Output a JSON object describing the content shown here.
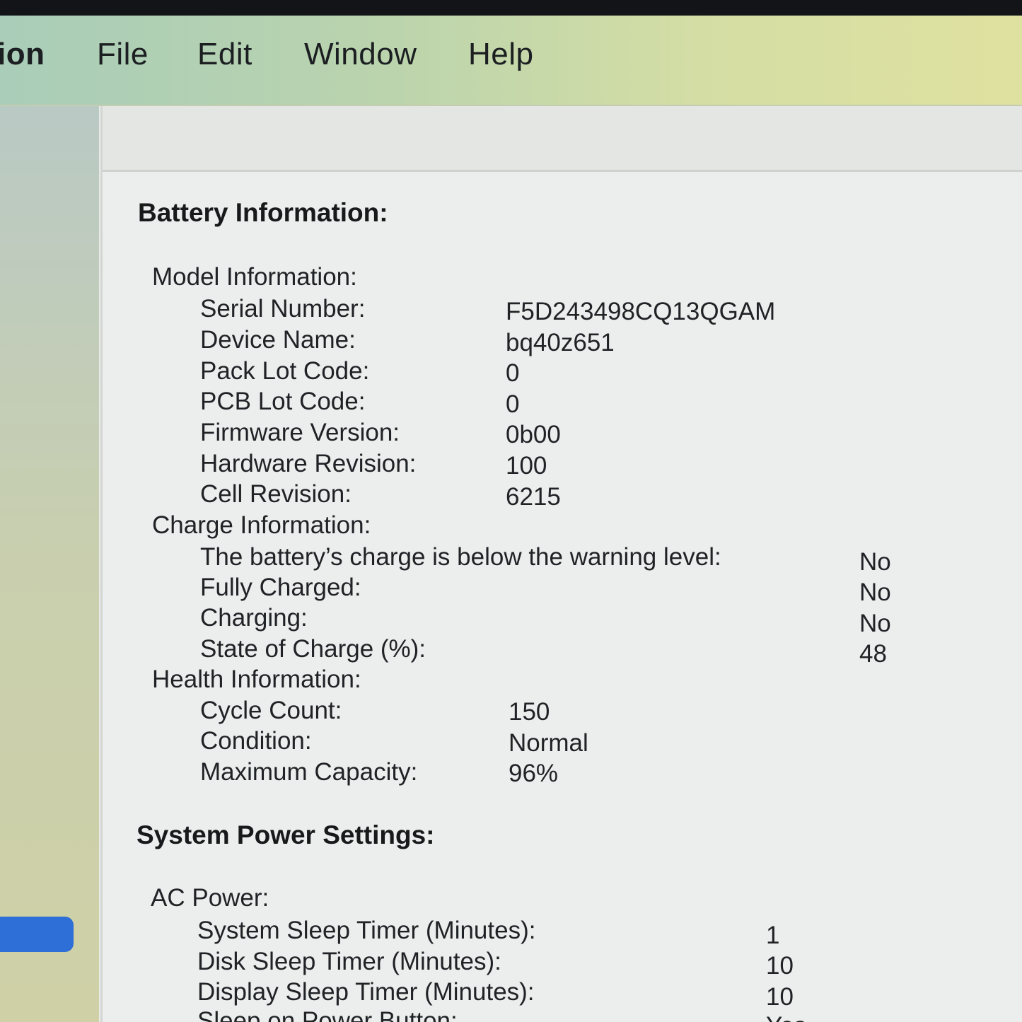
{
  "menubar": {
    "app_name": "ion",
    "items": [
      "File",
      "Edit",
      "Window",
      "Help"
    ]
  },
  "battery": {
    "title": "Battery Information:",
    "model": {
      "heading": "Model Information:",
      "rows": [
        {
          "label": "Serial Number:",
          "value": "F5D243498CQ13QGAM"
        },
        {
          "label": "Device Name:",
          "value": "bq40z651"
        },
        {
          "label": "Pack Lot Code:",
          "value": "0"
        },
        {
          "label": "PCB Lot Code:",
          "value": "0"
        },
        {
          "label": "Firmware Version:",
          "value": "0b00"
        },
        {
          "label": "Hardware Revision:",
          "value": "100"
        },
        {
          "label": "Cell Revision:",
          "value": "6215"
        }
      ]
    },
    "charge": {
      "heading": "Charge Information:",
      "rows": [
        {
          "label": "The battery’s charge is below the warning level:",
          "value": "No"
        },
        {
          "label": "Fully Charged:",
          "value": "No"
        },
        {
          "label": "Charging:",
          "value": "No"
        },
        {
          "label": "State of Charge (%):",
          "value": "48"
        }
      ]
    },
    "health": {
      "heading": "Health Information:",
      "rows": [
        {
          "label": "Cycle Count:",
          "value": "150"
        },
        {
          "label": "Condition:",
          "value": "Normal"
        },
        {
          "label": "Maximum Capacity:",
          "value": "96%"
        }
      ]
    }
  },
  "power": {
    "title": "System Power Settings:",
    "ac": {
      "heading": "AC Power:",
      "rows": [
        {
          "label": "System Sleep Timer (Minutes):",
          "value": "1"
        },
        {
          "label": "Disk Sleep Timer (Minutes):",
          "value": "10"
        },
        {
          "label": "Display Sleep Timer (Minutes):",
          "value": "10"
        },
        {
          "label": "Sleep on Power Button:",
          "value": "Yes"
        }
      ]
    }
  }
}
